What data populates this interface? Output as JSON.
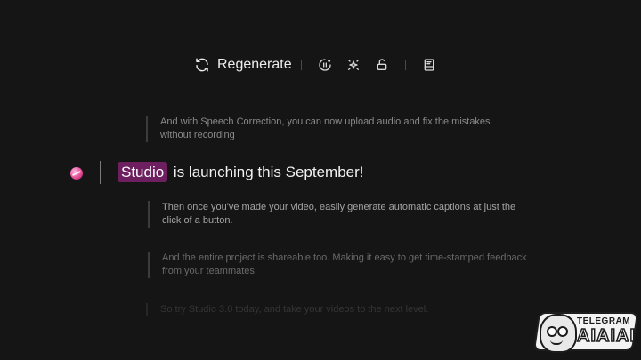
{
  "toolbar": {
    "regenerate_label": "Regenerate",
    "icons": [
      "refresh-icon",
      "speed-icon",
      "sparkle-icon",
      "unlock-icon",
      "book-icon"
    ]
  },
  "script": {
    "paragraph_1": "And with Speech Correction, you can now upload audio and fix the mistakes without recording",
    "active_highlight": "Studio",
    "active_rest": " is launching this September!",
    "paragraph_2": "Then once you've made your video, easily generate automatic captions at just the click of a button.",
    "paragraph_3": "And the entire project is shareable too. Making it easy to get time-stamped feedback from your teammates.",
    "paragraph_4": "So try Studio 3.0 today, and take your videos to the next level."
  },
  "watermark": {
    "top": "TELEGRAM",
    "bottom": "AIAIAI"
  },
  "colors": {
    "background": "#151515",
    "highlight": "#6e1f60",
    "avatar": "#e2478f"
  }
}
